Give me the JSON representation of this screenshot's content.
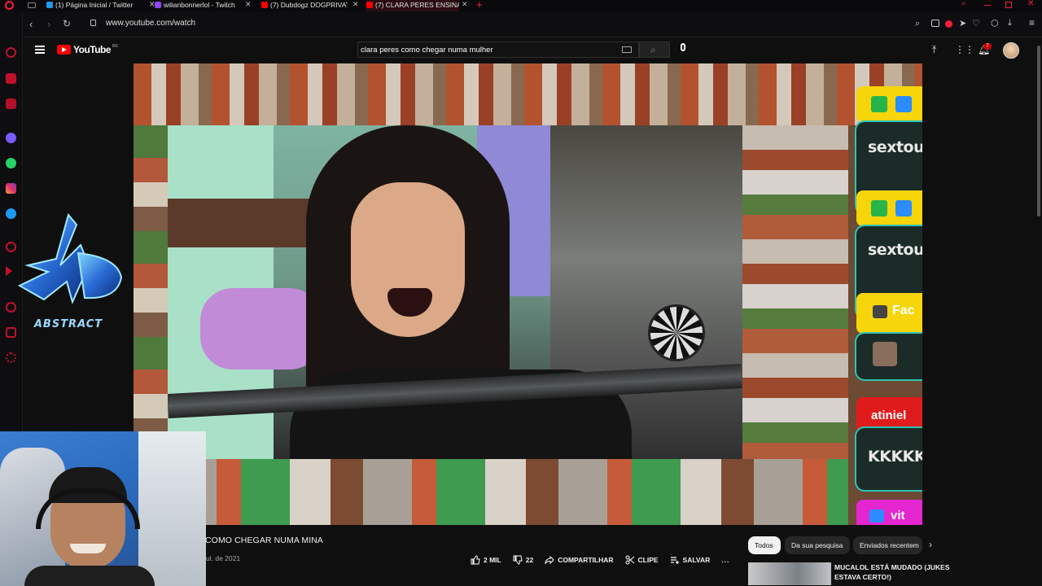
{
  "browser": {
    "tabs": [
      {
        "label": "(1) Página Inicial / Twitter",
        "favicon": "twitter-favicon",
        "color": "#1d9bf0"
      },
      {
        "label": "wilianbonnerlol - Twitch",
        "favicon": "twitch-favicon",
        "color": "#9146ff"
      },
      {
        "label": "(7) Dubdogz DOGPRIVATE",
        "favicon": "youtube-favicon",
        "color": "#ff0000"
      },
      {
        "label": "(7) CLARA PERES ENSINA C",
        "favicon": "youtube-favicon",
        "color": "#ff0000"
      }
    ],
    "url": "www.youtube.com/watch",
    "accent": "#ff1b3c"
  },
  "youtube": {
    "logo_text": "YouTube",
    "country": "BR",
    "search_value": "clara peres como chegar numa mulher",
    "notification_count": "7"
  },
  "overlay": {
    "logo_text": "ABSTRACT"
  },
  "video": {
    "chat_words": [
      "sextou",
      "sextou",
      "Fac",
      "atiniel",
      "KKKKK",
      "vit"
    ],
    "title": "COMO CHEGAR NUMA MINA",
    "date": "ul. de 2021",
    "likes": "2 MIL",
    "comments": "22",
    "share_label": "COMPARTILHAR",
    "clip_label": "CLIPE",
    "save_label": "SALVAR",
    "more_label": "..."
  },
  "sidebar_filters": [
    "Todos",
    "Da sua pesquisa",
    "Enviados recentem"
  ],
  "recommended": {
    "title": "MUCALOL ESTÁ MUDADO (JUKES ESTAVA CERTO!)"
  }
}
